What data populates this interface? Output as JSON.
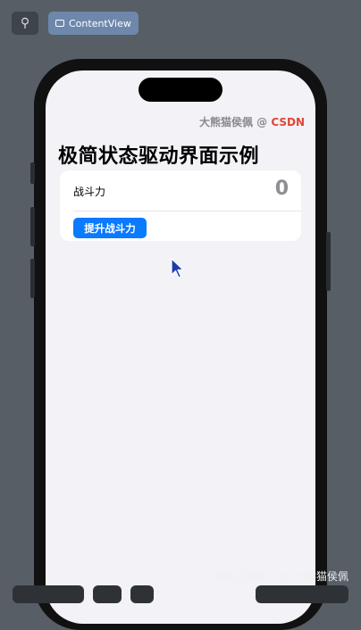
{
  "toolbar": {
    "pin_icon": "pin-icon",
    "content_view_tab": "ContentView"
  },
  "screen": {
    "credit_author": "大熊猫侯佩 @ ",
    "credit_brand": "CSDN",
    "title": "极简状态驱动界面示例",
    "row_label": "战斗力",
    "row_value": "0",
    "boost_button": "提升战斗力"
  },
  "watermark": "掘金技术社区 @ 大熊猫侯佩",
  "colors": {
    "accent": "#0a7aff",
    "brand": "#e0453a",
    "background": "#575e66"
  }
}
